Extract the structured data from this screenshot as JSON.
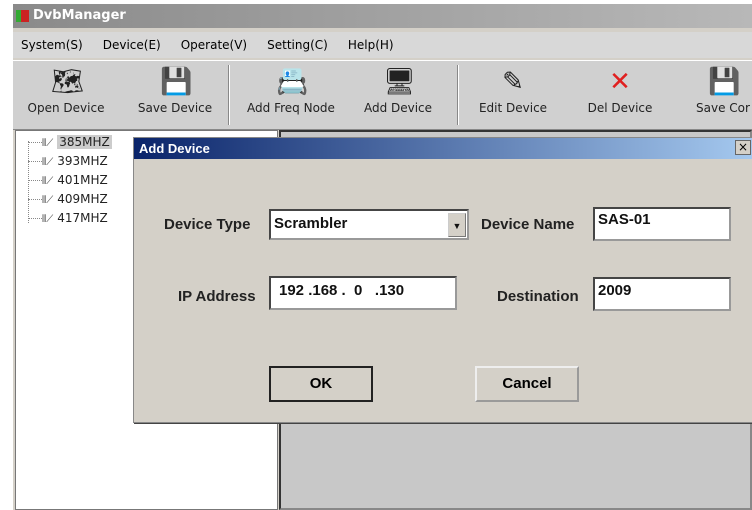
{
  "app": {
    "title": "DvbManager"
  },
  "menu": [
    "System(S)",
    "Device(E)",
    "Operate(V)",
    "Setting(C)",
    "Help(H)"
  ],
  "toolbar": [
    {
      "label": "Open Device",
      "icon": "open-device-icon",
      "glyph": "🗺"
    },
    {
      "label": "Save Device",
      "icon": "save-device-icon",
      "glyph": "💾"
    },
    {
      "label": "Add Freq Node",
      "icon": "add-freq-node-icon",
      "glyph": "📇"
    },
    {
      "label": "Add Device",
      "icon": "add-device-icon",
      "glyph": "🖥"
    },
    {
      "label": "Edit Device",
      "icon": "edit-device-icon",
      "glyph": "✎"
    },
    {
      "label": "Del Device",
      "icon": "del-device-icon",
      "glyph": "✕"
    },
    {
      "label": "Save Cor",
      "icon": "save-config-icon",
      "glyph": "💾"
    }
  ],
  "tree": [
    "385MHZ",
    "393MHZ",
    "401MHZ",
    "409MHZ",
    "417MHZ"
  ],
  "dialog": {
    "title": "Add Device",
    "close": "×",
    "device_type_label": "Device Type",
    "device_type": "Scrambler",
    "device_name_label": "Device Name",
    "device_name": "SAS-01",
    "ip_label": "IP Address",
    "ip": "192 .168 .  0   .130",
    "destination_label": "Destination",
    "destination": "2009",
    "ok": "OK",
    "cancel": "Cancel"
  },
  "colors": {
    "dialog_title": "#0a246a",
    "del_icon": "#e02020"
  }
}
